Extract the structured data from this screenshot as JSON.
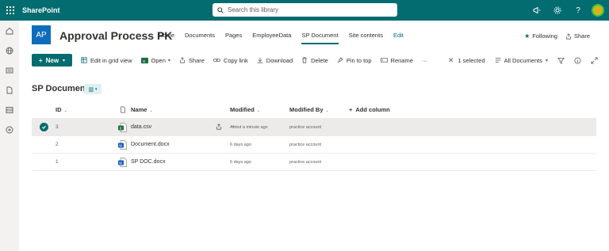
{
  "suite": {
    "app_name": "SharePoint",
    "search_placeholder": "Search this library",
    "icons": [
      "waffle-icon",
      "megaphone-icon",
      "gear-icon",
      "help-icon"
    ],
    "colors": {
      "suite_bg": "#036c70",
      "accent": "#036c70"
    }
  },
  "site": {
    "logo_text": "AP",
    "title": "Approval Process PK",
    "nav": [
      {
        "label": "Home"
      },
      {
        "label": "Documents"
      },
      {
        "label": "Pages"
      },
      {
        "label": "EmployeeData"
      },
      {
        "label": "SP Document",
        "active": true
      },
      {
        "label": "Site contents"
      },
      {
        "label": "Edit"
      }
    ],
    "following_label": "Following",
    "share_label": "Share"
  },
  "commands": {
    "new_label": "New",
    "items": [
      {
        "label": "Edit in grid view",
        "icon": "grid-icon"
      },
      {
        "label": "Open",
        "icon": "excel-icon",
        "dropdown": true
      },
      {
        "label": "Share",
        "icon": "share-icon"
      },
      {
        "label": "Copy link",
        "icon": "link-icon"
      },
      {
        "label": "Download",
        "icon": "download-icon"
      },
      {
        "label": "Delete",
        "icon": "delete-icon"
      },
      {
        "label": "Pin to top",
        "icon": "pin-icon"
      },
      {
        "label": "Rename",
        "icon": "rename-icon"
      }
    ],
    "more_label": "···",
    "selected_label": "1 selected",
    "view_label": "All Documents"
  },
  "library": {
    "title": "SP Document",
    "columns": {
      "id": "ID",
      "name": "Name",
      "modified": "Modified",
      "modified_by": "Modified By",
      "add_column": "Add column"
    },
    "rows": [
      {
        "id": "3",
        "name": "data.csv",
        "modified": "About a minute ago",
        "modified_by": "practice account",
        "type": "csv",
        "selected": true
      },
      {
        "id": "2",
        "name": "Document.docx",
        "modified": "6 days ago",
        "modified_by": "practice account",
        "type": "docx",
        "selected": false
      },
      {
        "id": "1",
        "name": "SP DOC.docx",
        "modified": "6 days ago",
        "modified_by": "practice account",
        "type": "docx",
        "selected": false
      }
    ]
  }
}
